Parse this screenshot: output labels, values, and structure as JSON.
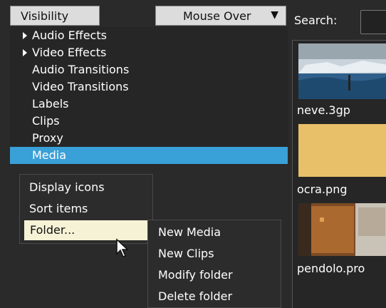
{
  "toolbar": {
    "visibility_label": "Visibility",
    "mouse_over_label": "Mouse Over",
    "search_label": "Search:",
    "search_value": ""
  },
  "tree": {
    "items": [
      {
        "label": "Audio Effects",
        "expandable": true
      },
      {
        "label": "Video Effects",
        "expandable": true
      },
      {
        "label": "Audio Transitions",
        "expandable": false
      },
      {
        "label": "Video Transitions",
        "expandable": false
      },
      {
        "label": "Labels",
        "expandable": false
      },
      {
        "label": "Clips",
        "expandable": false
      },
      {
        "label": "Proxy",
        "expandable": false
      },
      {
        "label": "Media",
        "expandable": false,
        "selected": true
      }
    ]
  },
  "context_menu": {
    "items": [
      "Display icons",
      "Sort items",
      "Folder..."
    ],
    "highlighted": "Folder..."
  },
  "submenu": {
    "items": [
      "New Media",
      "New Clips",
      "Modify folder",
      "Delete folder"
    ]
  },
  "media": {
    "items": [
      {
        "label": "neve.3gp"
      },
      {
        "label": "ocra.png"
      },
      {
        "label": "pendolo.pro"
      }
    ]
  },
  "colors": {
    "selection": "#3aa0d8",
    "menu_highlight": "#f5f2d6",
    "ocra": "#e8c06a"
  }
}
